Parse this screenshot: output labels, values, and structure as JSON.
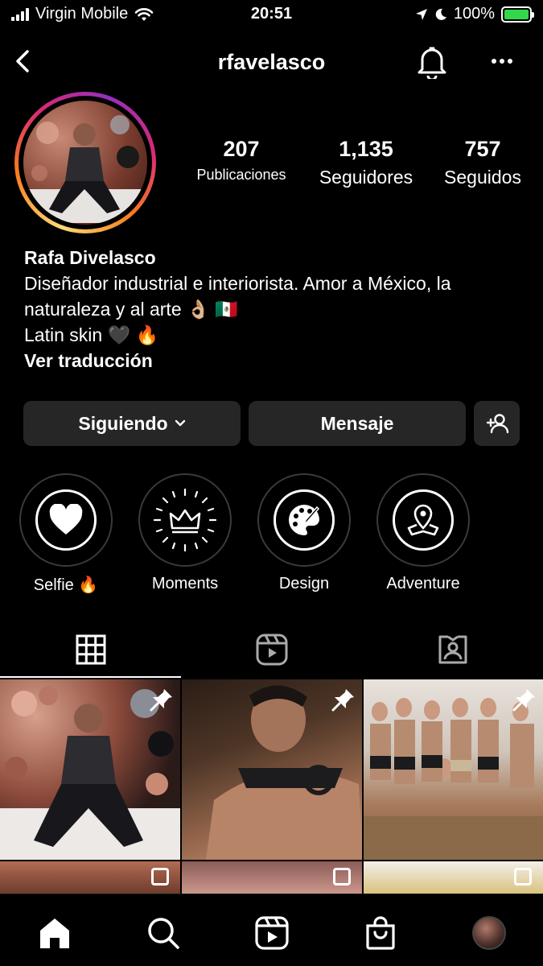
{
  "status_bar": {
    "carrier": "Virgin Mobile",
    "time": "20:51",
    "battery": "100%",
    "battery_color": "#32d74b"
  },
  "header": {
    "username": "rfavelasco",
    "back_icon": "chevron-left-icon",
    "bell_icon": "bell-icon",
    "more_icon": "more-horizontal-icon"
  },
  "profile": {
    "stats": [
      {
        "value": "207",
        "label": "Publicaciones"
      },
      {
        "value": "1,135",
        "label": "Seguidores"
      },
      {
        "value": "757",
        "label": "Seguidos"
      }
    ],
    "name": "Rafa Divelasco",
    "bio_line1": "Diseñador industrial e interiorista. Amor a México, la",
    "bio_line2": "naturaleza y al arte 👌🏼 🇲🇽",
    "bio_line3": "Latin skin 🖤 🔥",
    "translate_label": "Ver traducción"
  },
  "actions": {
    "following_label": "Siguiendo",
    "message_label": "Mensaje",
    "add_person_icon": "add-person-icon"
  },
  "highlights": [
    {
      "label": "Selfie 🔥",
      "icon": "heart-icon"
    },
    {
      "label": "Moments",
      "icon": "crown-icon"
    },
    {
      "label": "Design",
      "icon": "palette-icon"
    },
    {
      "label": "Adventure",
      "icon": "map-pin-icon"
    }
  ],
  "tabs": [
    {
      "icon": "grid-icon",
      "active": true
    },
    {
      "icon": "reels-icon",
      "active": false
    },
    {
      "icon": "tagged-icon",
      "active": false
    }
  ],
  "bottom_nav": [
    "home-icon",
    "search-icon",
    "reels-icon",
    "shop-icon",
    "profile-avatar"
  ],
  "theme": {
    "background": "#000000",
    "button_bg": "#262626",
    "text": "#ffffff"
  }
}
